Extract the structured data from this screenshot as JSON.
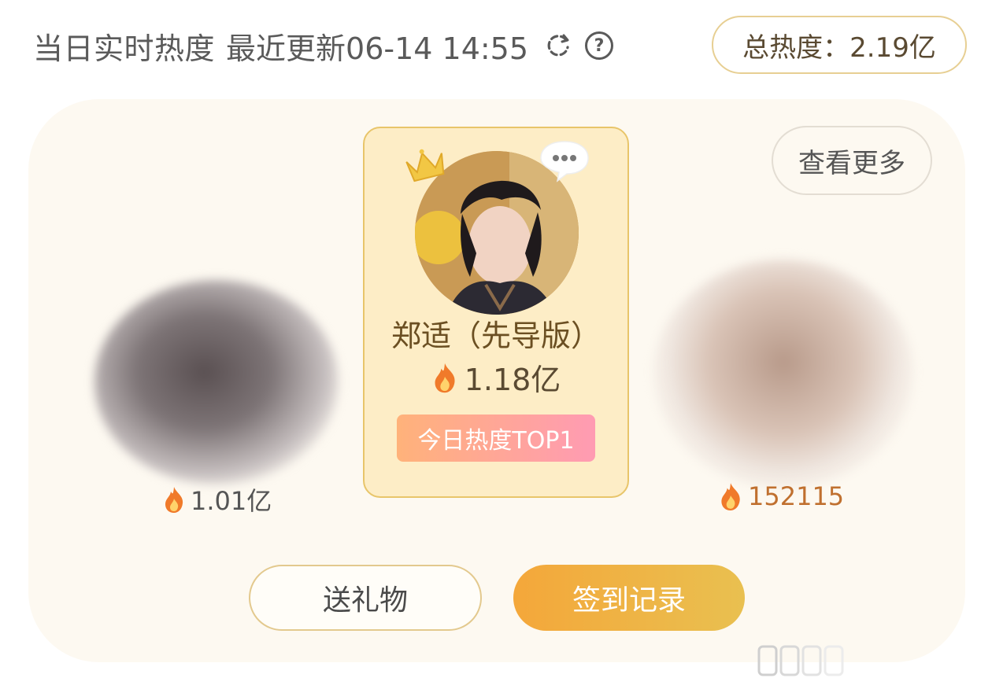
{
  "header": {
    "title": "当日实时热度",
    "update_text": "最近更新06-14 14:55",
    "help_symbol": "?",
    "total_heat_label": "总热度：2.19亿"
  },
  "actions": {
    "more_label": "查看更多",
    "gift_label": "送礼物",
    "checkin_label": "签到记录"
  },
  "top1": {
    "name": "郑适（先导版）",
    "heat": "1.18亿",
    "badge": "今日热度TOP1"
  },
  "left_entry": {
    "heat": "1.01亿"
  },
  "right_entry": {
    "heat": "152115"
  },
  "colors": {
    "accent_gold": "#e8c56a",
    "card_bg": "#fdf9f1",
    "badge_start": "#ffb27a",
    "badge_end": "#ff9bb3",
    "checkin_start": "#f4a73a",
    "checkin_end": "#e9c050",
    "fire": "#f07a2a"
  }
}
